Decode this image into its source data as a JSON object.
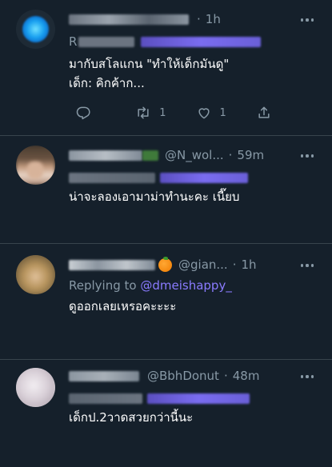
{
  "tweets": [
    {
      "handle": "",
      "time": "1h",
      "reply_prefix": "R",
      "text_lines": [
        "มากับสโลแกน \"ทำให้เด็กมันดู\"",
        "เด็ก: คิกค้าก..."
      ],
      "replies": "",
      "retweets": "1",
      "likes": "1"
    },
    {
      "handle": "@N_wol...",
      "time": "59m",
      "text_lines": [
        "น่าจะลองเอามาม่าทำนะคะ เนี๊ยบ"
      ]
    },
    {
      "handle": "@gian...",
      "time": "1h",
      "reply_label": "Replying to",
      "reply_to": "@dmeishappy_",
      "text_lines": [
        "ดูออกเลยเหรอคะะะะ"
      ]
    },
    {
      "handle": "@BbhDonut",
      "time": "48m",
      "text_lines": [
        "เด็กป.2วาดสวยกว่านี้นะ"
      ]
    }
  ],
  "colors": {
    "background": "#15202b",
    "divider": "#38444d",
    "secondary_text": "#8899a6",
    "link": "#8a7bff"
  },
  "icons": [
    "reply-icon",
    "retweet-icon",
    "like-icon",
    "share-icon",
    "more-icon"
  ]
}
